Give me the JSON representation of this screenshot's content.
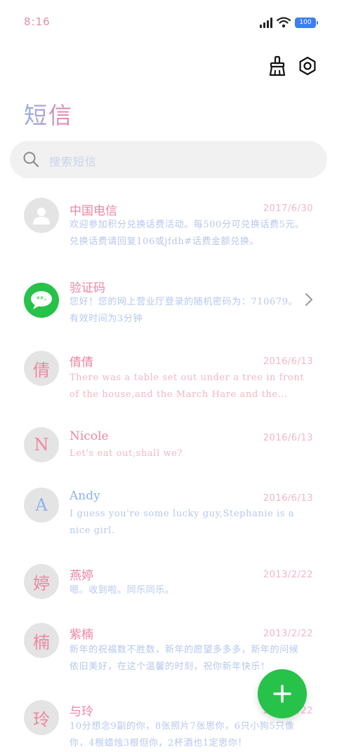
{
  "status_bar": {
    "time": "8:16",
    "battery": "100"
  },
  "header": {
    "title": "短信"
  },
  "search": {
    "placeholder": "搜索短信"
  },
  "messages": [
    {
      "sender": "中国电信",
      "date": "2017/6/30",
      "preview": "欢迎参加积分兑换话费活动。每500分可兑换话费5元。兑换话费请回复106或jfdh#话费金额兑换。",
      "avatar_type": "person-icon",
      "sender_color": "#ee86a2",
      "preview_color": "#b7c7ee"
    },
    {
      "sender": "验证码",
      "date": "",
      "preview": "您好！您的网上营业厅登录的随机密码为：710679。有效时间为3分钟",
      "avatar_type": "message-bubble-icon",
      "sender_color": "#ee86a2",
      "preview_color": "#b7c7ee"
    },
    {
      "sender": "倩倩",
      "date": "2016/6/13",
      "preview": "There was a table set out under a tree in front of the house,and the March Hare and the Hatter were having tea at it.",
      "avatar_letter": "倩",
      "sender_color": "#ee86a2",
      "preview_color": "#f3b6c5"
    },
    {
      "sender": "Nicole",
      "date": "2016/6/13",
      "preview": "Let's eat out,shall we?",
      "avatar_letter": "N",
      "sender_color": "#ee86a2",
      "preview_color": "#f3b6c5"
    },
    {
      "sender": "Andy",
      "date": "2016/6/13",
      "preview": "I guess you're some lucky guy,Stephanie is a nice girl.",
      "avatar_letter": "A",
      "sender_color": "#8fb1e8",
      "preview_color": "#b7c7ee"
    },
    {
      "sender": "燕婷",
      "date": "2013/2/22",
      "preview": "嗯。收到啦。同乐同乐。",
      "avatar_letter": "婷",
      "sender_color": "#ee86a2",
      "preview_color": "#b7c7ee"
    },
    {
      "sender": "紫楠",
      "date": "2013/2/22",
      "preview": "新年的祝福数不胜数，新年的愿望多多多，新年的问候依旧美好，在这个温馨的时刻，祝你新年快乐！",
      "avatar_letter": "楠",
      "sender_color": "#ee86a2",
      "preview_color": "#b7c7ee"
    },
    {
      "sender": "与玲",
      "date": "2013/2/22",
      "preview": "10分想念9副的你，8张照片7张思你，6只小狗5只像你，4根蜡烛3根但你，2杯酒也1定思你！",
      "avatar_letter": "玲",
      "sender_color": "#ee86a2",
      "preview_color": "#b7c7ee"
    }
  ],
  "colors": {
    "accent_green": "#26c24a",
    "pink": "#ee86a2",
    "blue": "#8fb1e8"
  }
}
